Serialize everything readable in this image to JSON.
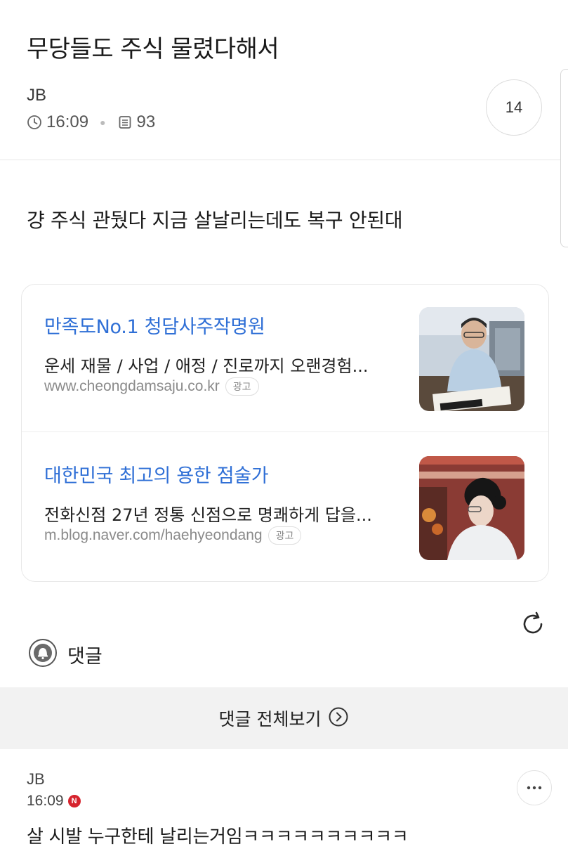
{
  "post": {
    "title": "무당들도 주식 물렸다해서",
    "author": "JB",
    "time": "16:09",
    "views": "93",
    "comment_count": "14",
    "body": "걍 주식 관뒀다 지금 살날리는데도 복구 안된대"
  },
  "ads": [
    {
      "title": "만족도No.1 청담사주작명원",
      "description": "운세 재물 / 사업 / 애정 / 진로까지 오랜경험...",
      "url": "www.cheongdamsaju.co.kr",
      "badge": "광고"
    },
    {
      "title": "대한민국 최고의 용한 점술가",
      "description": "전화신점 27년 정통 신점으로 명쾌하게 답을...",
      "url": "m.blog.naver.com/haehyeondang",
      "badge": "광고"
    }
  ],
  "comments_section": {
    "label": "댓글",
    "view_all": "댓글 전체보기"
  },
  "comment": {
    "author": "JB",
    "time": "16:09",
    "badge": "N",
    "text": "살 시발 누구한테 날리는거임ㅋㅋㅋㅋㅋㅋㅋㅋㅋㅋ"
  },
  "icons": {
    "clock": "clock-icon",
    "views": "document-icon",
    "refresh": "refresh-icon",
    "bell": "bell-icon",
    "view_all": "chevron-right-circle-icon",
    "more": "more-dots-icon"
  },
  "colors": {
    "ad_title": "#2f6fd6",
    "new_badge": "#d6232d",
    "view_all_bg": "#f2f2f2"
  }
}
